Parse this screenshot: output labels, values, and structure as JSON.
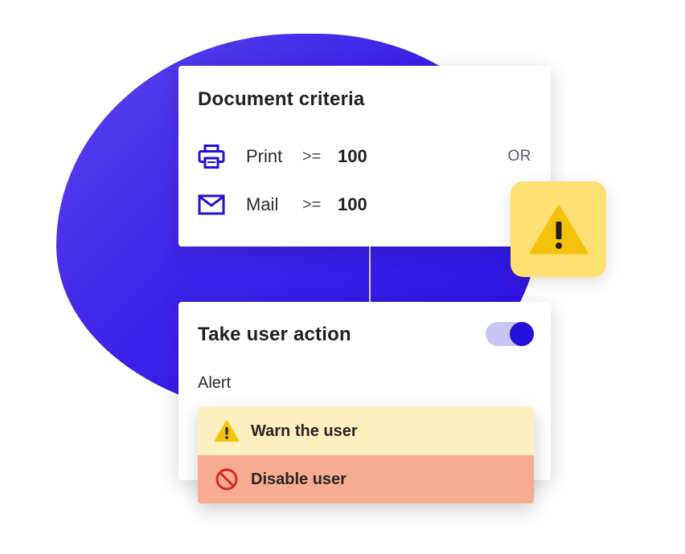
{
  "criteria": {
    "title": "Document criteria",
    "rows": [
      {
        "icon": "printer-icon",
        "label": "Print",
        "operator": ">=",
        "value": "100"
      },
      {
        "icon": "mail-icon",
        "label": "Mail",
        "operator": ">=",
        "value": "100"
      }
    ],
    "joiner": "OR"
  },
  "action": {
    "title": "Take user action",
    "toggle_on": true,
    "alert_label": "Alert",
    "options": [
      {
        "icon": "warning-icon",
        "label": "Warn the user"
      },
      {
        "icon": "prohibited-icon",
        "label": "Disable user"
      }
    ]
  },
  "badge": {
    "icon": "warning-icon"
  },
  "colors": {
    "accent": "#2311d8",
    "blob": "#3a22e8",
    "warning_tile": "#fde071",
    "warn_row": "#fdf0bf",
    "disable_row": "#f7ac92"
  }
}
